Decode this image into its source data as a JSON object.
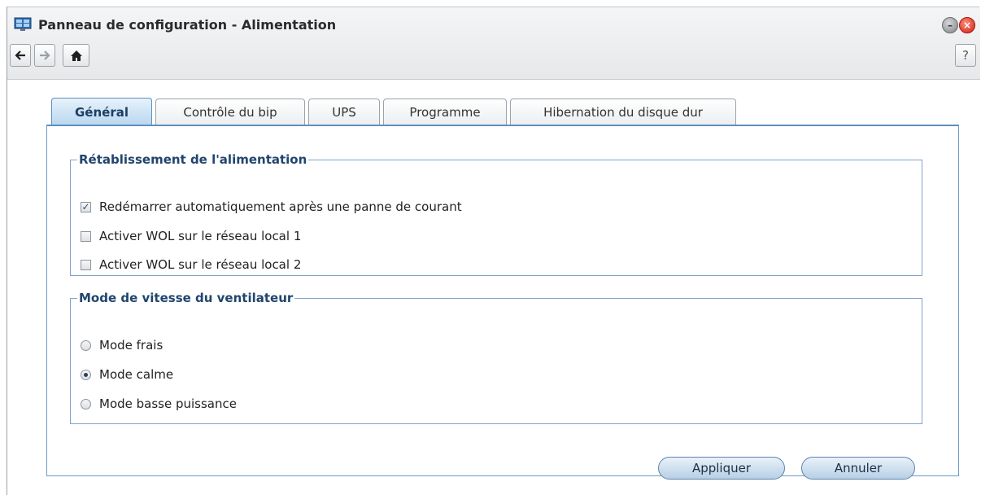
{
  "window": {
    "title": "Panneau de configuration - Alimentation",
    "app_icon": "control-panel-icon",
    "help_label": "?"
  },
  "nav": {
    "back_icon": "arrow-left-icon",
    "forward_icon": "arrow-right-icon",
    "home_icon": "home-icon"
  },
  "tabs": [
    {
      "label": "Général",
      "active": true
    },
    {
      "label": "Contrôle du bip",
      "active": false
    },
    {
      "label": "UPS",
      "active": false
    },
    {
      "label": "Programme",
      "active": false
    },
    {
      "label": "Hibernation du disque dur",
      "active": false
    }
  ],
  "power_recovery": {
    "legend": "Rétablissement de l'alimentation",
    "options": [
      {
        "label": "Redémarrer automatiquement après une panne de courant",
        "checked": true
      },
      {
        "label": "Activer WOL sur le réseau local 1",
        "checked": false
      },
      {
        "label": "Activer WOL sur le réseau local 2",
        "checked": false
      }
    ]
  },
  "fan_mode": {
    "legend": "Mode de vitesse du ventilateur",
    "options": [
      {
        "label": "Mode frais",
        "selected": false
      },
      {
        "label": "Mode calme",
        "selected": true
      },
      {
        "label": "Mode basse puissance",
        "selected": false
      }
    ]
  },
  "actions": {
    "apply_label": "Appliquer",
    "cancel_label": "Annuler"
  },
  "colors": {
    "accent": "#5f8fbf",
    "legend_text": "#21456e",
    "close_button": "#d01f10"
  }
}
